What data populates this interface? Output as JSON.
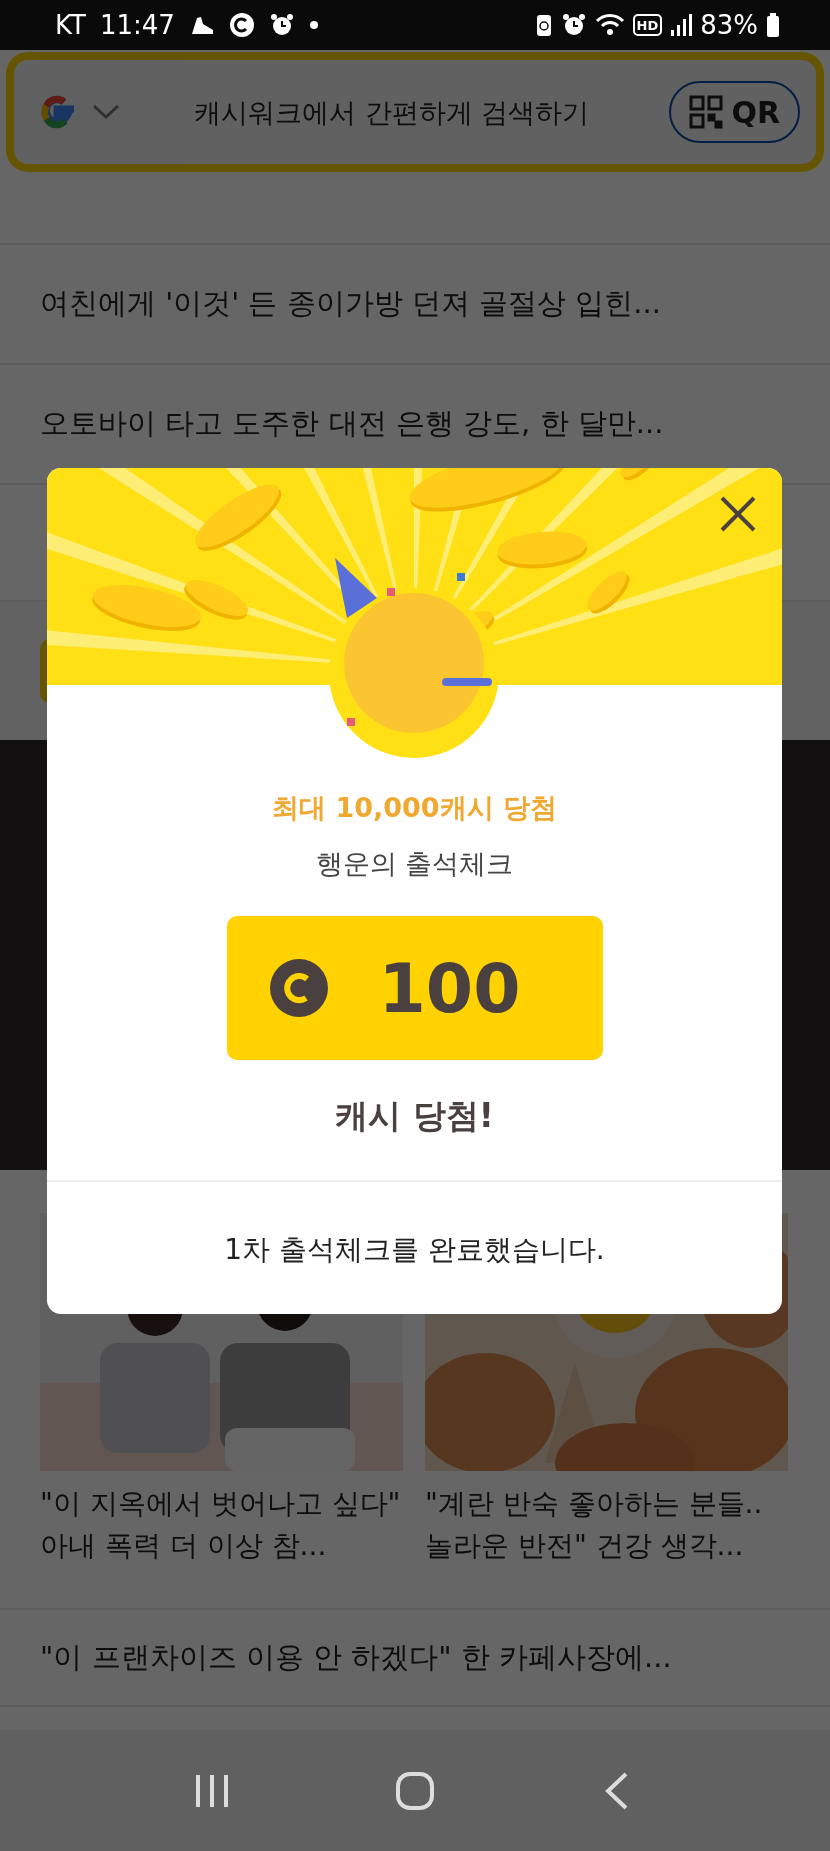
{
  "status_bar": {
    "carrier": "KT",
    "time": "11:47",
    "hd_label": "HD",
    "battery": "83%"
  },
  "search_bar": {
    "placeholder": "캐시워크에서 간편하게 검색하기",
    "qr_label": "QR"
  },
  "headlines": [
    {
      "text": "여친에게 '이것' 든 종이가방 던져 골절상 입힌..."
    },
    {
      "text": "오토바이 타고 도주한 대전 은행 강도, 한 달만..."
    }
  ],
  "cards": [
    {
      "kind": "couple",
      "caption": "\"이 지옥에서 벗어나고 싶다\" 아내 폭력 더 이상 참..."
    },
    {
      "kind": "eggs",
      "caption": "\"계란 반숙 좋아하는 분들..놀라운 반전\" 건강 생각..."
    }
  ],
  "bottom_headline": "\"이 프랜차이즈 이용 안 하겠다\" 한 카페사장에...",
  "modal": {
    "subtitle": "최대 10,000캐시 당첨",
    "title": "행운의 출석체크",
    "amount": "100",
    "result": "캐시 당첨!",
    "message": "1차 출석체크를 완료했습니다."
  }
}
